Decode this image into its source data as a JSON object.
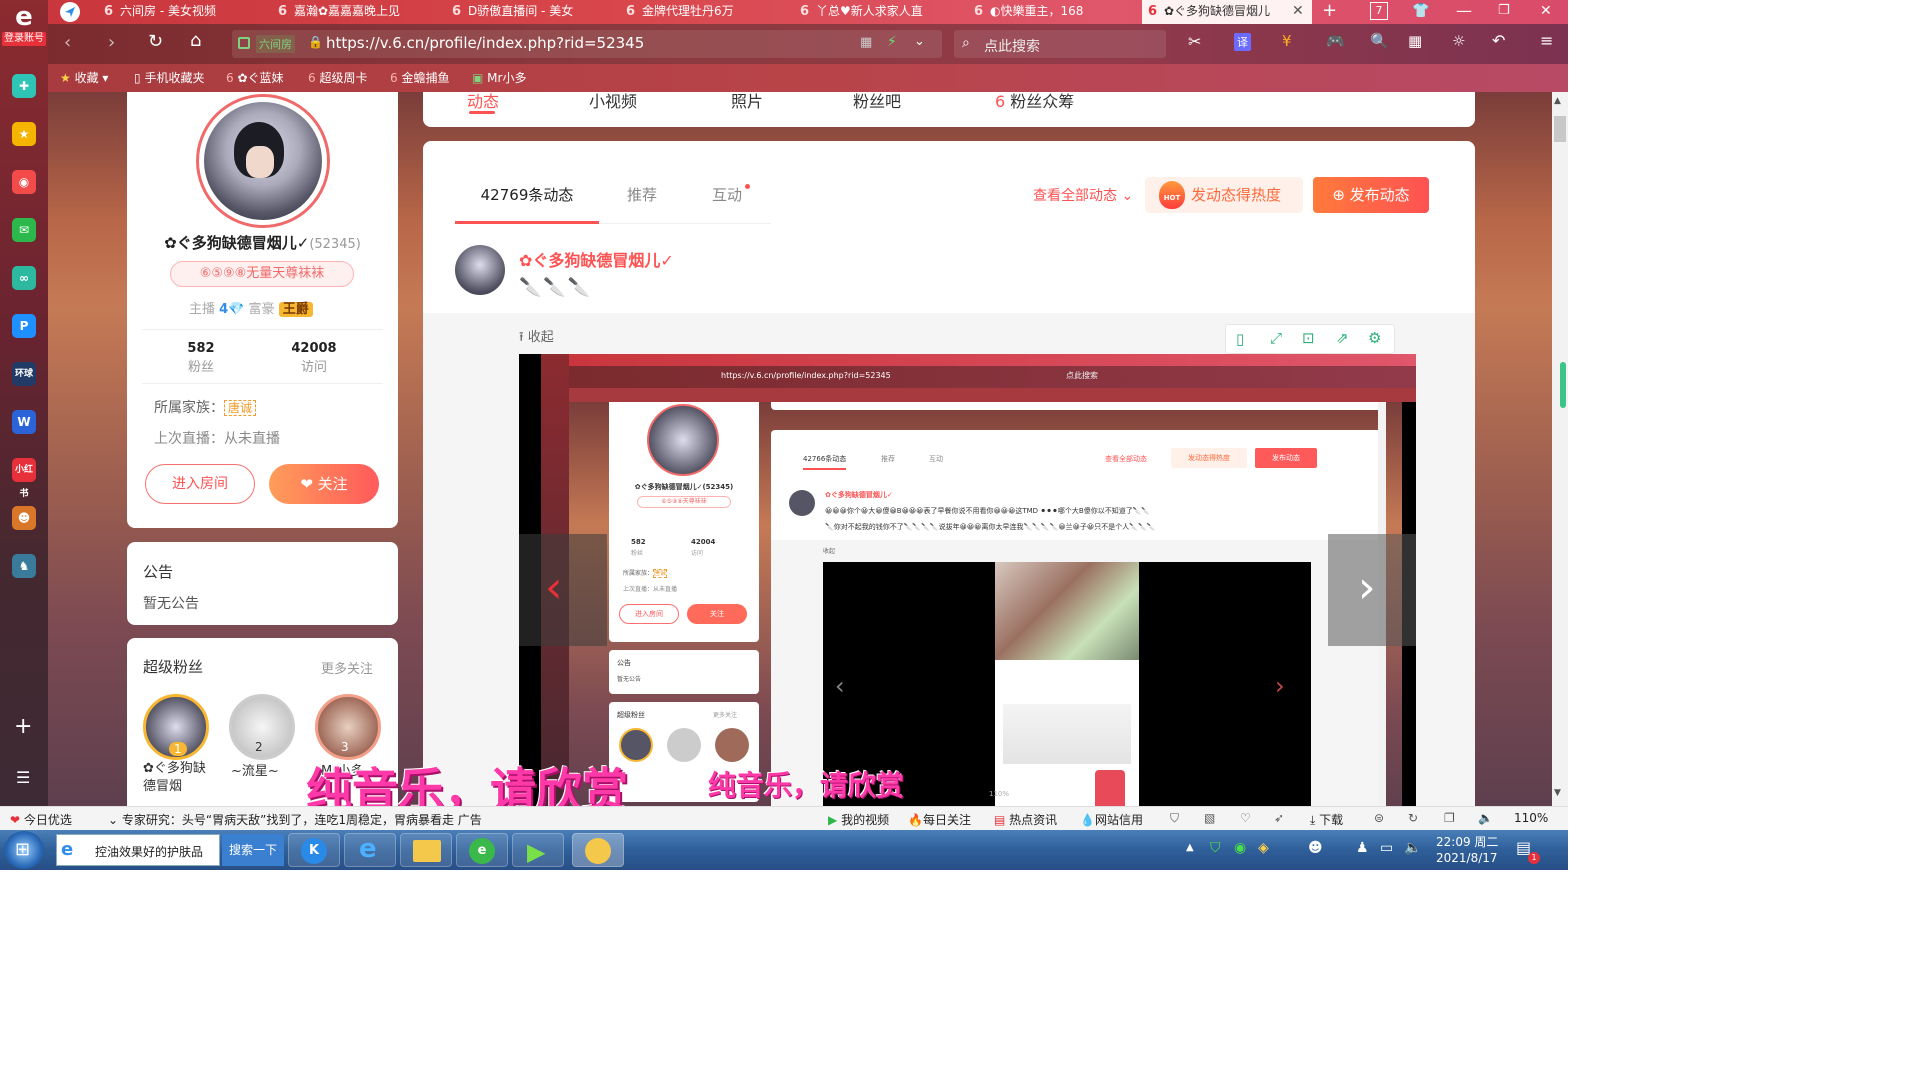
{
  "browser": {
    "tabs": [
      {
        "title": "六间房 - 美女视频"
      },
      {
        "title": "嘉瀚✿嘉嘉嘉晚上见"
      },
      {
        "title": "D骄傲直播间 - 美女"
      },
      {
        "title": "金牌代理牡丹6万"
      },
      {
        "title": "丫总♥新人求家人直"
      },
      {
        "title": "◐快樂重主，168"
      },
      {
        "title": "✿ぐ多狗缺德冒烟儿"
      }
    ],
    "url": "https://v.6.cn/profile/index.php?rid=52345",
    "url_badge": "六间房",
    "search_placeholder": "点此搜索",
    "translate_label": "译",
    "login_badge": "登录账号",
    "tab_count": "7",
    "bookmarks": [
      "收藏",
      "手机收藏夹",
      "ぐ蓝妹",
      "超级周卡",
      "金蟾捕鱼",
      "Mr小多"
    ]
  },
  "profile": {
    "name": "✿ぐ多狗缺德冒烟儿✓",
    "rid": "(52345)",
    "fan_badge": "⑥⑤⑨⑧无量天尊袜袜",
    "anchor_label": "主播",
    "rich_label": "富豪",
    "rich_rank": "王爵",
    "fans_count": "582",
    "fans_label": "粉丝",
    "visits_count": "42008",
    "visits_label": "访问",
    "family_label": "所属家族：",
    "family_tag": "唐诚",
    "last_live": "上次直播：从未直播",
    "enter_room": "进入房间",
    "follow": "关注"
  },
  "notice": {
    "title": "公告",
    "text": "暂无公告"
  },
  "super_fans": {
    "title": "超级粉丝",
    "more": "更多关注",
    "fans": [
      {
        "rank": "1",
        "name": "✿ぐ多狗缺德冒烟"
      },
      {
        "rank": "2",
        "name": "~流星~"
      },
      {
        "rank": "3",
        "name": "Mr小多"
      }
    ]
  },
  "top_nav": [
    "动态",
    "小视频",
    "照片",
    "粉丝吧",
    "粉丝众筹"
  ],
  "feed": {
    "tabs": [
      {
        "label": "42769条动态"
      },
      {
        "label": "推荐"
      },
      {
        "label": "互动"
      }
    ],
    "view_all": "查看全部动态",
    "hot_button": "发动态得热度",
    "hot_badge": "HOT",
    "publish_button": "发布动态",
    "post_author": "✿ぐ多狗缺德冒烟儿✓",
    "collapse": "收起"
  },
  "nested": {
    "url": "https://v.6.cn/profile/index.php?rid=52345",
    "search": "点此搜索",
    "tab_dyn": "42766条动态",
    "tab_rec": "推荐",
    "tab_int": "互动",
    "view_all": "查看全部动态",
    "hot": "发动态得热度",
    "publish": "发布动态",
    "author": "✿ぐ多狗缺德冒烟儿✓",
    "post_line1": "😀😀😀你个😀大😀傻😀B😀😀😀表了早餐你说不用看你😀😀😀这TMD ⚫⚫⚫哪个大B傻你以不知道了🔪🔪",
    "post_line2": "🔪你对不起我的钱你不了🔪🔪🔪🔪说拔年😀😀😀离你太早连我🔪🔪🔪🔪😀兰😀子😀只不是个人🔪🔪🔪",
    "collapse": "收起",
    "name": "✿ぐ多狗缺德冒烟儿✓(52345)",
    "badge": "⑥⑤⑨⑧天尊袜袜",
    "fans": "582",
    "fans_label": "粉丝",
    "visits": "42004",
    "visits_label": "访问",
    "family": "所属家族：",
    "family_tag": "唐诚",
    "last_live": "上次直播：从未直播",
    "enter": "进入房间",
    "follow": "关注",
    "notice": "公告",
    "notice_text": "暂无公告",
    "super_fans": "超级粉丝",
    "more": "更多关注",
    "zoom": "110%"
  },
  "overlay_captions": [
    "纯音乐，请欣赏",
    "纯音乐，请欣赏"
  ],
  "newsbar": {
    "today": "今日优选",
    "headline": "专家研究：头号“胃病天敌”找到了，连吃1周稳定，胃病暴看走 广告",
    "items": [
      "我的视频",
      "每日关注",
      "热点资讯",
      "网站信用",
      "下载"
    ],
    "zoom": "110%"
  },
  "taskbar": {
    "search_query": "控油效果好的护肤品",
    "search_button": "搜索一下",
    "time": "22:09 周二",
    "date": "2021/8/17",
    "notif_count": "1"
  },
  "colors": {
    "accent": "#ff5252",
    "brand_red": "#e8303a",
    "orange": "#ff8a3c"
  }
}
